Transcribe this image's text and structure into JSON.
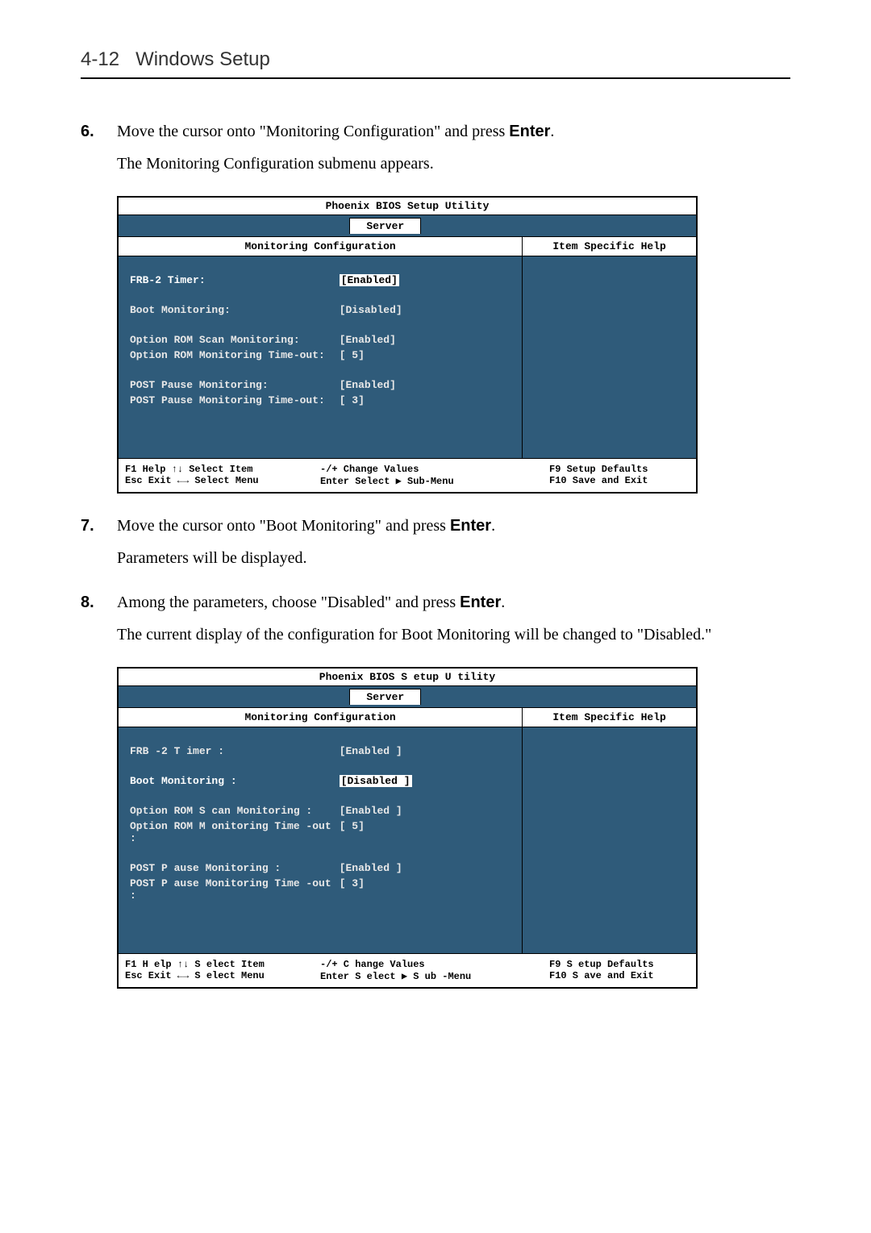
{
  "header": {
    "page_num": "4-12",
    "section": "Windows Setup"
  },
  "step6": {
    "num": "6.",
    "text_a": "Move the cursor onto \"Monitoring Configuration\" and press ",
    "enter": "Enter",
    "text_b": ".",
    "after": "The Monitoring Configuration submenu appears."
  },
  "bios1": {
    "title": "Phoenix BIOS Setup Utility",
    "tab": "Server",
    "sub_header": "Monitoring Configuration",
    "help_header": "Item Specific Help",
    "rows": {
      "r0": {
        "label": "FRB-2 Timer:",
        "value": "[Enabled]",
        "selected": true,
        "highlight": true
      },
      "r1": {
        "label": "Boot Monitoring:",
        "value": "[Disabled]",
        "selected": false,
        "highlight": false
      },
      "r2": {
        "label": "Option ROM Scan Monitoring:",
        "value": "[Enabled]",
        "selected": false,
        "highlight": false
      },
      "r3": {
        "label": "Option ROM Monitoring Time-out:",
        "value": "[   5]",
        "selected": false,
        "highlight": false
      },
      "r4": {
        "label": "POST Pause Monitoring:",
        "value": "[Enabled]",
        "selected": false,
        "highlight": false
      },
      "r5": {
        "label": "POST Pause Monitoring Time-out:",
        "value": "[   3]",
        "selected": false,
        "highlight": false
      }
    },
    "footer": {
      "c1a": "F1   Help      ↑↓   Select Item",
      "c1b": "Esc  Exit      ←→ Select Menu",
      "c2a": "-/+     Change Values",
      "c2b": "Enter Select    ▶ Sub-Menu",
      "c3a": "F9  Setup Defaults",
      "c3b": "F10 Save and Exit"
    }
  },
  "step7": {
    "num": "7.",
    "text_a": "Move the cursor onto \"Boot Monitoring\" and press ",
    "enter": "Enter",
    "text_b": ".",
    "after": "Parameters will be displayed."
  },
  "step8": {
    "num": "8.",
    "text_a": "Among the parameters, choose \"Disabled\" and press ",
    "enter": "Enter",
    "text_b": ".",
    "after": "The current display of the configuration for Boot Monitoring will be changed to \"Disabled.\""
  },
  "bios2": {
    "title": "Phoenix   BIOS S etup  U tility",
    "tab": "Server",
    "sub_header": "Monitoring   Configuration",
    "help_header": "Item  Specific  Help",
    "rows": {
      "r0": {
        "label": "FRB -2 T imer  :",
        "value": "[Enabled ]",
        "selected": false,
        "highlight": false
      },
      "r1": {
        "label": "Boot  Monitoring  :",
        "value": "[Disabled ]",
        "selected": true,
        "highlight": true
      },
      "r2": {
        "label": "Option  ROM S can  Monitoring  :",
        "value": "[Enabled ]",
        "selected": false,
        "highlight": false
      },
      "r3": {
        "label": "Option  ROM M onitoring   Time -out :",
        "value": "[   5]",
        "selected": false,
        "highlight": false
      },
      "r4": {
        "label": "POST P ause  Monitoring  :",
        "value": "[Enabled ]",
        "selected": false,
        "highlight": false
      },
      "r5": {
        "label": "POST P ause  Monitoring   Time -out :",
        "value": "[   3]",
        "selected": false,
        "highlight": false
      }
    },
    "footer": {
      "c1a": "F1  H elp       ↑↓  S elect  Item",
      "c1b": "Esc  Exit      ←→ S elect  Menu",
      "c2a": "-/+    C hange  Values",
      "c2b": "Enter  S elect     ▶ S ub -Menu",
      "c3a": "F9 S etup  Defaults",
      "c3b": "F10 S ave  and  Exit"
    }
  }
}
